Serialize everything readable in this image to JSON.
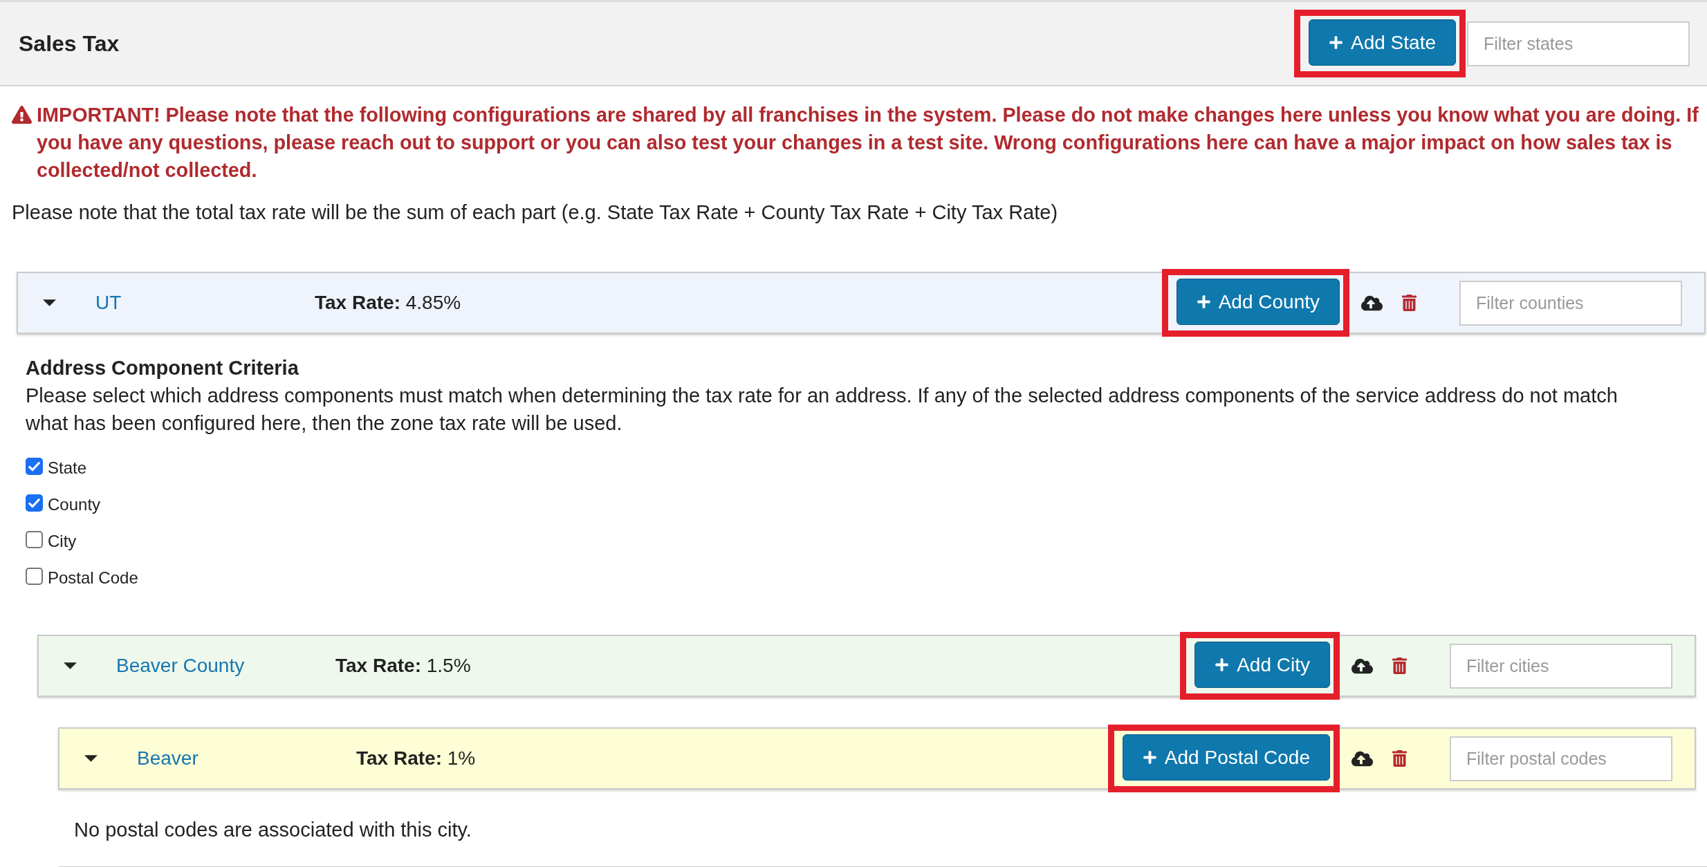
{
  "header": {
    "title": "Sales Tax",
    "add_button": {
      "label": "Add State",
      "highlighted": true
    },
    "filter": {
      "placeholder": "Filter states"
    }
  },
  "warning": "IMPORTANT! Please note that the following configurations are shared by all franchises in the system. Please do not make changes here unless you know what you are doing. If you have any questions, please reach out to support or you can also test your changes in a test site. Wrong configurations here can have a major impact on how sales tax is collected/not collected.",
  "note": "Please note that the total tax rate will be the sum of each part (e.g. State Tax Rate + County Tax Rate + City Tax Rate)",
  "states": [
    {
      "name": "UT",
      "expanded": true,
      "tax_rate": "**Tax Rate:** 4.85%",
      "add_button": {
        "label": "Add County",
        "highlighted": true
      },
      "filter": {
        "placeholder": "Filter counties"
      },
      "criteria": {
        "title": "Address Component Criteria",
        "description": "Please select which address components must match when determining the tax rate for an address. If any of the selected address components of the service address do not match what has been configured here, then the zone tax rate will be used.",
        "options": [
          {
            "label": "State",
            "checked": true
          },
          {
            "label": "County",
            "checked": true
          },
          {
            "label": "City",
            "checked": false
          },
          {
            "label": "Postal Code",
            "checked": false
          }
        ]
      },
      "counties": [
        {
          "name": "Beaver County",
          "expanded": true,
          "tax_rate": "**Tax Rate:** 1.5%",
          "add_button": {
            "label": "Add City",
            "highlighted": true
          },
          "filter": {
            "placeholder": "Filter cities"
          },
          "cities": [
            {
              "name": "Beaver",
              "expanded": true,
              "tax_rate": "**Tax Rate:** 1%",
              "add_button": {
                "label": "Add Postal Code",
                "highlighted": true
              },
              "filter": {
                "placeholder": "Filter postal codes"
              },
              "empty_message": "No postal codes are associated with this city."
            }
          ]
        }
      ]
    }
  ]
}
